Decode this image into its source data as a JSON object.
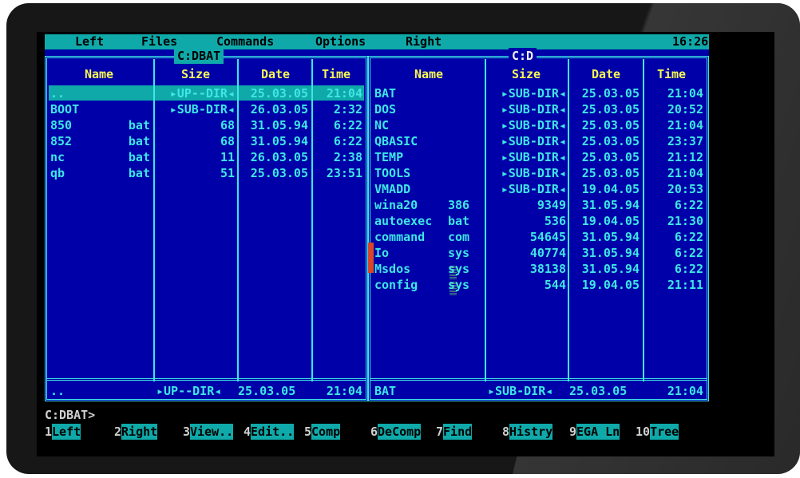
{
  "menu": {
    "items": [
      "Left",
      "Files",
      "Commands",
      "Options",
      "Right"
    ],
    "clock": "16:26"
  },
  "left_panel": {
    "path": "C:DBAT",
    "columns": [
      "Name",
      "Size",
      "Date",
      "Time"
    ],
    "rows": [
      {
        "name": "..",
        "ext": "",
        "size": "▸UP--DIR◂",
        "date": "25.03.05",
        "time": "21:04"
      },
      {
        "name": "BOOT",
        "ext": "",
        "size": "▸SUB-DIR◂",
        "date": "26.03.05",
        "time": "2:32"
      },
      {
        "name": "850",
        "ext": "bat",
        "size": "68",
        "date": "31.05.94",
        "time": "6:22"
      },
      {
        "name": "852",
        "ext": "bat",
        "size": "68",
        "date": "31.05.94",
        "time": "6:22"
      },
      {
        "name": "nc",
        "ext": "bat",
        "size": "11",
        "date": "26.03.05",
        "time": "2:38"
      },
      {
        "name": "qb",
        "ext": "bat",
        "size": "51",
        "date": "25.03.05",
        "time": "23:51"
      }
    ],
    "status": {
      "name": "..",
      "size": "▸UP--DIR◂",
      "date": "25.03.05",
      "time": "21:04"
    }
  },
  "right_panel": {
    "path": "C:D",
    "columns": [
      "Name",
      "Size",
      "Date",
      "Time"
    ],
    "rows": [
      {
        "name": "BAT",
        "ext": "",
        "size": "▸SUB-DIR◂",
        "date": "25.03.05",
        "time": "21:04"
      },
      {
        "name": "DOS",
        "ext": "",
        "size": "▸SUB-DIR◂",
        "date": "25.03.05",
        "time": "20:52"
      },
      {
        "name": "NC",
        "ext": "",
        "size": "▸SUB-DIR◂",
        "date": "25.03.05",
        "time": "21:04"
      },
      {
        "name": "QBASIC",
        "ext": "",
        "size": "▸SUB-DIR◂",
        "date": "25.03.05",
        "time": "23:37"
      },
      {
        "name": "TEMP",
        "ext": "",
        "size": "▸SUB-DIR◂",
        "date": "25.03.05",
        "time": "21:12"
      },
      {
        "name": "TOOLS",
        "ext": "",
        "size": "▸SUB-DIR◂",
        "date": "25.03.05",
        "time": "21:04"
      },
      {
        "name": "VMADD",
        "ext": "",
        "size": "▸SUB-DIR◂",
        "date": "19.04.05",
        "time": "20:53"
      },
      {
        "name": "wina20",
        "ext": "386",
        "size": "9349",
        "date": "31.05.94",
        "time": "6:22"
      },
      {
        "name": "autoexec",
        "ext": "bat",
        "size": "536",
        "date": "19.04.05",
        "time": "21:30"
      },
      {
        "name": "command",
        "ext": "com",
        "size": "54645",
        "date": "31.05.94",
        "time": "6:22"
      },
      {
        "name": "Io",
        "ext": "sys",
        "size": "40774",
        "date": "31.05.94",
        "time": "6:22"
      },
      {
        "name": "Msdos",
        "ext": "sys",
        "size": "38138",
        "date": "31.05.94",
        "time": "6:22"
      },
      {
        "name": "config",
        "ext": "sys",
        "size": "544",
        "date": "19.04.05",
        "time": "21:11"
      }
    ],
    "status": {
      "name": "BAT",
      "size": "▸SUB-DIR◂",
      "date": "25.03.05",
      "time": "21:04"
    }
  },
  "prompt": "C:DBAT>",
  "keybar": [
    {
      "num": "1",
      "label": "Left   "
    },
    {
      "num": "2",
      "label": "Right "
    },
    {
      "num": "3",
      "label": "View.. "
    },
    {
      "num": "4",
      "label": "Edit.. "
    },
    {
      "num": "5",
      "label": "Comp   "
    },
    {
      "num": "6",
      "label": "DeComp "
    },
    {
      "num": "7",
      "label": "Find   "
    },
    {
      "num": "8",
      "label": "Histry "
    },
    {
      "num": "9",
      "label": "EGA Ln "
    },
    {
      "num": "10",
      "label": "Tree    "
    }
  ],
  "colors": {
    "panel_bg": "#0000a8",
    "frame": "#3ee6e6",
    "menu_bg": "#10a9a9",
    "header_text": "#f8f854",
    "marker": "#d8462a"
  }
}
